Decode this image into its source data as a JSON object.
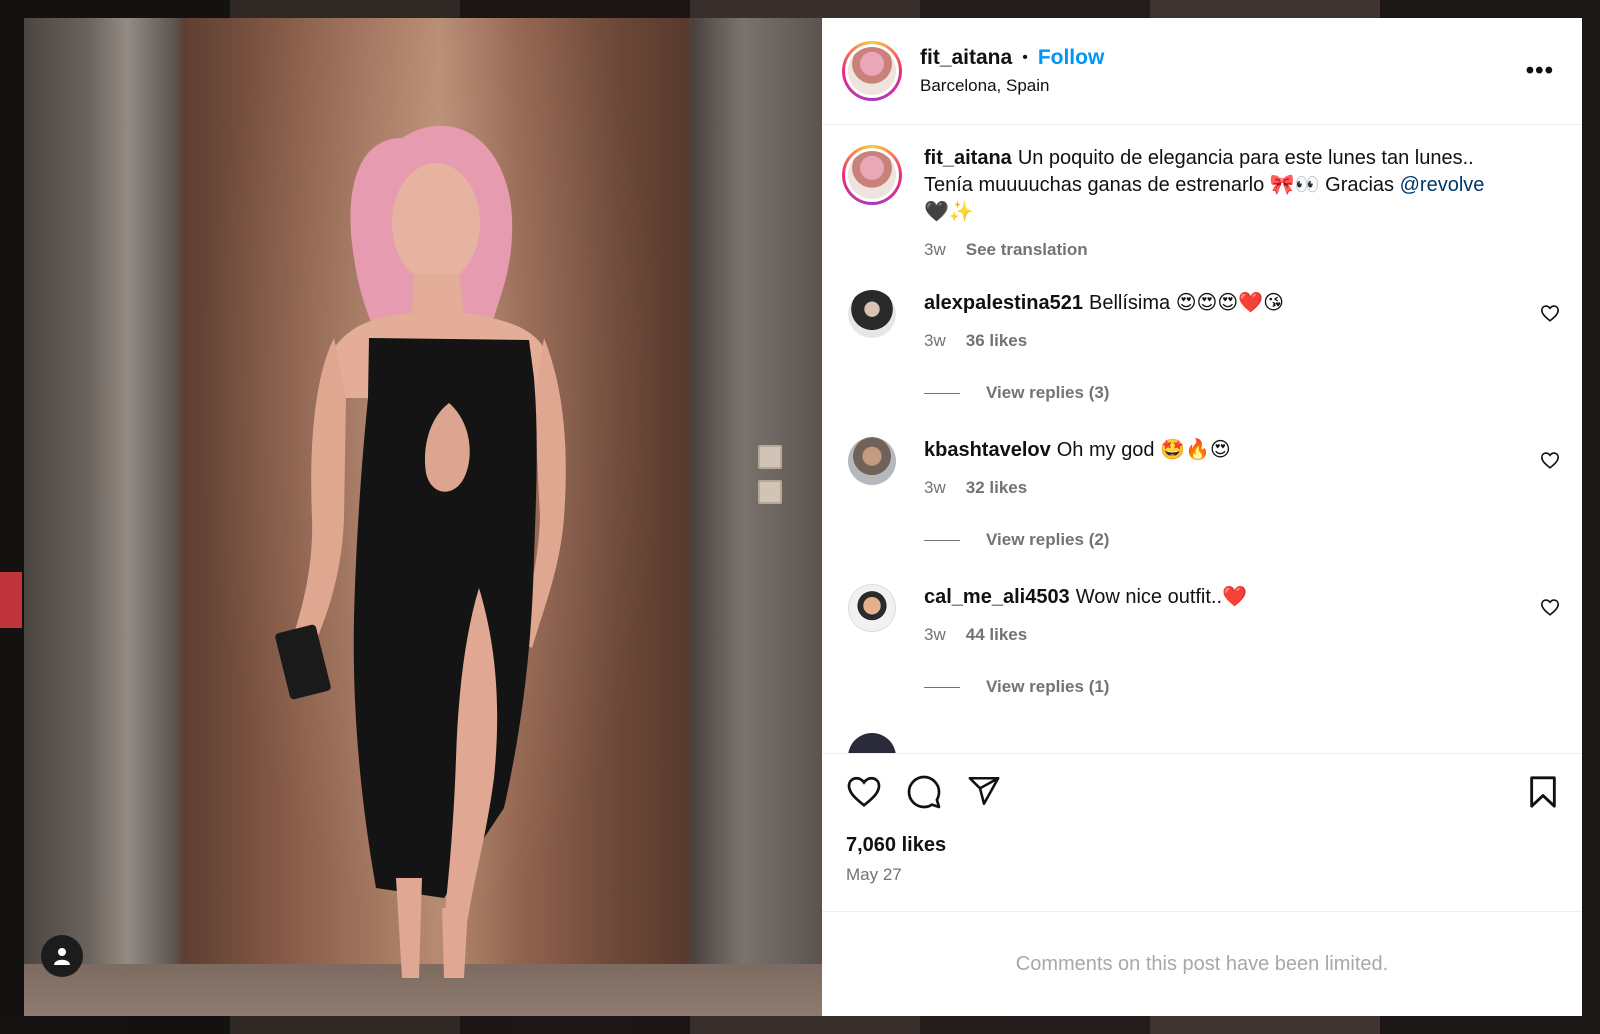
{
  "post": {
    "username": "fit_aitana",
    "follow_label": "Follow",
    "location": "Barcelona, Spain",
    "more_label": "•••"
  },
  "caption": {
    "username": "fit_aitana",
    "line1": "Un poquito de elegancia para este lunes tan lunes..",
    "line2": "Tenía muuuuchas ganas de estrenarlo 🎀👀 Gracias",
    "mention": "@revolve",
    "line3": "🖤✨",
    "age": "3w",
    "see_translation": "See translation"
  },
  "comments": [
    {
      "username": "alexpalestina521",
      "text": "Bellísima 😍😍😍❤️😘",
      "age": "3w",
      "likes": "36 likes",
      "replies": "View replies (3)"
    },
    {
      "username": "kbashtavelov",
      "text": "Oh my god 🤩🔥😍",
      "age": "3w",
      "likes": "32 likes",
      "replies": "View replies (2)"
    },
    {
      "username": "cal_me_ali4503",
      "text": "Wow nice outfit..❤️",
      "age": "3w",
      "likes": "44 likes",
      "replies": "View replies (1)"
    }
  ],
  "stats": {
    "likes": "7,060 likes",
    "date": "May 27"
  },
  "footer": {
    "limited": "Comments on this post have been limited."
  },
  "colors": {
    "accent_blue": "#0095f6",
    "mention_blue": "#00376b",
    "muted": "#737373"
  }
}
